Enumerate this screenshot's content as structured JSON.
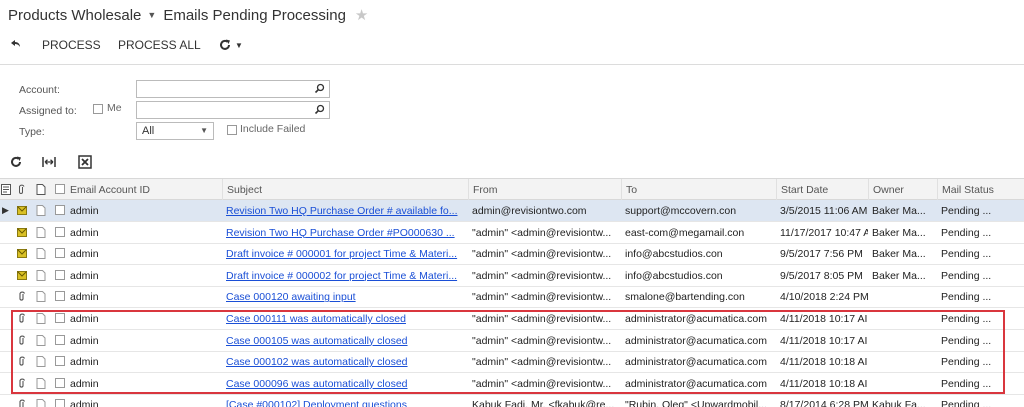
{
  "header": {
    "company": "Products Wholesale",
    "screen_title": "Emails Pending Processing"
  },
  "toolbar": {
    "process_label": "PROCESS",
    "process_all_label": "PROCESS ALL"
  },
  "filter": {
    "account_label": "Account:",
    "assigned_label": "Assigned to:",
    "me_label": "Me",
    "type_label": "Type:",
    "type_value": "All",
    "include_failed_label": "Include Failed"
  },
  "grid": {
    "columns": [
      "Email Account ID",
      "Subject",
      "From",
      "To",
      "Start Date",
      "Owner",
      "Mail Status"
    ],
    "rows": [
      {
        "account": "admin",
        "subject": "Revision Two HQ Purchase Order # available fo...",
        "from": "admin@revisiontwo.com",
        "to": "support@mccovern.con",
        "start": "3/5/2015 11:06 AM",
        "owner": "Baker Ma...",
        "status": "Pending ...",
        "icon": "envelope"
      },
      {
        "account": "admin",
        "subject": "Revision Two HQ Purchase Order #PO000630 ...",
        "from": "\"admin\" <admin@revisiontw...",
        "to": "east-com@megamail.con",
        "start": "11/17/2017 10:47 A",
        "owner": "Baker Ma...",
        "status": "Pending ...",
        "icon": "envelope"
      },
      {
        "account": "admin",
        "subject": "Draft invoice # 000001 for project Time & Materi...",
        "from": "\"admin\" <admin@revisiontw...",
        "to": "info@abcstudios.con",
        "start": "9/5/2017 7:56 PM",
        "owner": "Baker Ma...",
        "status": "Pending ...",
        "icon": "envelope"
      },
      {
        "account": "admin",
        "subject": "Draft invoice # 000002 for project Time & Materi...",
        "from": "\"admin\" <admin@revisiontw...",
        "to": "info@abcstudios.con",
        "start": "9/5/2017 8:05 PM",
        "owner": "Baker Ma...",
        "status": "Pending ...",
        "icon": "envelope"
      },
      {
        "account": "admin",
        "subject": "Case 000120 awaiting input",
        "from": "\"admin\" <admin@revisiontw...",
        "to": "smalone@bartending.con",
        "start": "4/10/2018 2:24 PM",
        "owner": "",
        "status": "Pending ...",
        "icon": "clip"
      },
      {
        "account": "admin",
        "subject": "Case 000111 was automatically closed",
        "from": "\"admin\" <admin@revisiontw...",
        "to": "administrator@acumatica.com",
        "start": "4/11/2018 10:17 AI",
        "owner": "",
        "status": "Pending ...",
        "icon": "clip"
      },
      {
        "account": "admin",
        "subject": "Case 000105 was automatically closed",
        "from": "\"admin\" <admin@revisiontw...",
        "to": "administrator@acumatica.com",
        "start": "4/11/2018 10:17 AI",
        "owner": "",
        "status": "Pending ...",
        "icon": "clip"
      },
      {
        "account": "admin",
        "subject": "Case 000102 was automatically closed",
        "from": "\"admin\" <admin@revisiontw...",
        "to": "administrator@acumatica.com",
        "start": "4/11/2018 10:18 AI",
        "owner": "",
        "status": "Pending ...",
        "icon": "clip"
      },
      {
        "account": "admin",
        "subject": "Case 000096 was automatically closed",
        "from": "\"admin\" <admin@revisiontw...",
        "to": "administrator@acumatica.com",
        "start": "4/11/2018 10:18 AI",
        "owner": "",
        "status": "Pending ...",
        "icon": "clip"
      },
      {
        "account": "admin",
        "subject": "[Case #000102] Deployment questions",
        "from": "Kabuk Fadi, Mr. <fkabuk@re...",
        "to": "\"Rubin, Oleg\" <Upwardmobil...",
        "start": "8/17/2014 6:28 PM",
        "owner": "Kabuk Fa...",
        "status": "Pending ...",
        "icon": "clip"
      }
    ]
  },
  "colors": {
    "link": "#1a4fd6",
    "highlight_border": "#d9363e",
    "selected_row": "#dde6f2",
    "envelope_icon": "#d9c025"
  }
}
